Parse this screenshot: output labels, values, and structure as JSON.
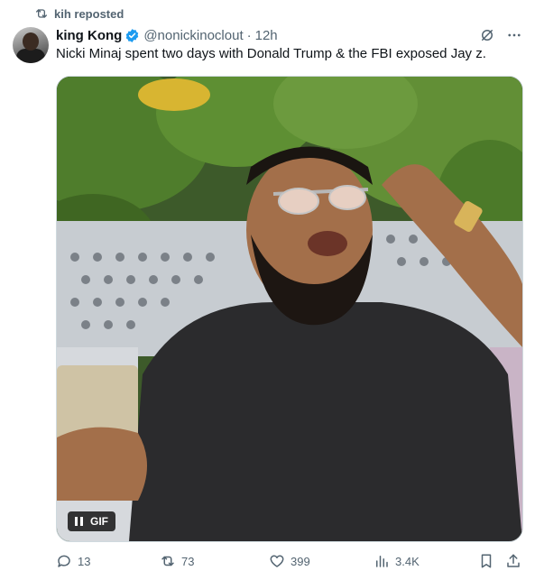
{
  "repost": {
    "label": "kih reposted",
    "icon": "repost-icon"
  },
  "tweet": {
    "author_name": "king Kong",
    "handle": "@nonickinoclout",
    "separator": "·",
    "time": "12h",
    "text": "Nicki Minaj spent two days with Donald Trump & the FBI exposed Jay z.",
    "verified": true
  },
  "media": {
    "badge_label": "GIF",
    "type": "gif"
  },
  "actions": {
    "replies": "13",
    "reposts": "73",
    "likes": "399",
    "views": "3.4K"
  },
  "colors": {
    "text_primary": "#0f1419",
    "text_secondary": "#536471",
    "verified_blue": "#1d9bf0",
    "border": "#cfd9de"
  },
  "icons": [
    "repost-icon",
    "verified-icon",
    "grok-icon",
    "more-icon",
    "reply-icon",
    "retweet-icon",
    "like-icon",
    "views-icon",
    "bookmark-icon",
    "share-icon",
    "pause-icon"
  ]
}
